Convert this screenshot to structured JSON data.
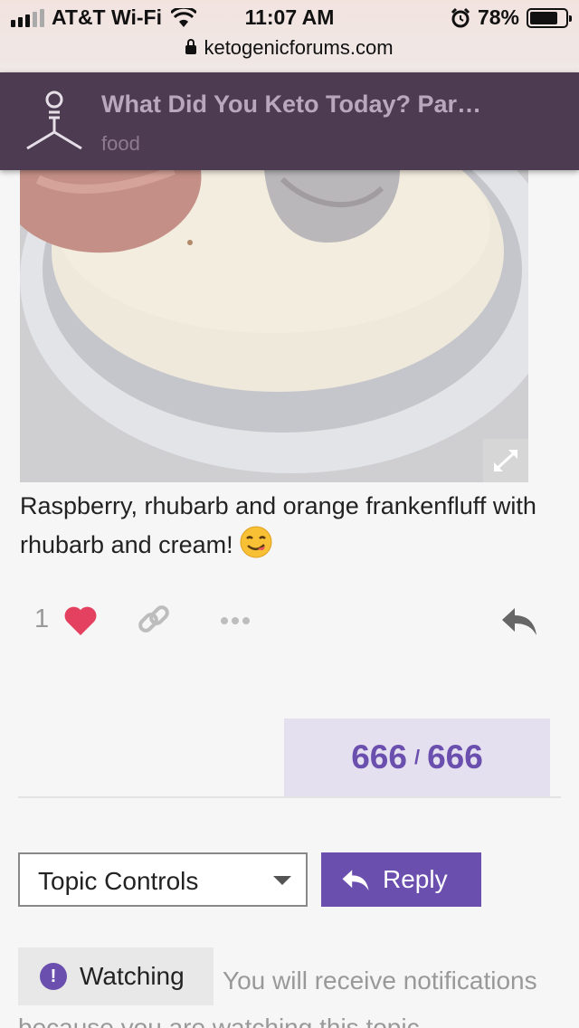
{
  "status_bar": {
    "carrier": "AT&T Wi-Fi",
    "time": "11:07 AM",
    "battery": "78%",
    "battery_level": 0.78,
    "url": "ketogenicforums.com",
    "icons": [
      "signal-icon",
      "wifi-icon",
      "alarm-icon",
      "battery-icon",
      "lock-icon"
    ]
  },
  "topic": {
    "title": "What Did You Keto Today? Par…",
    "category": "food"
  },
  "post": {
    "text": "Raspberry, rhubarb and orange frankenfluff with rhubarb and cream!",
    "like_count": "1",
    "icons": [
      "expand-icon",
      "heart-icon",
      "link-icon",
      "more-icon",
      "reply-icon",
      "yum-emoji"
    ]
  },
  "progress": {
    "current": "666",
    "separator": "/",
    "total": "666"
  },
  "controls": {
    "topic_controls_label": "Topic Controls",
    "reply_label": "Reply"
  },
  "notifications": {
    "level_label": "Watching",
    "level_icon": "!",
    "description": "You will receive notifications because you are watching this topic."
  },
  "colors": {
    "header_bg": "#4d3b52",
    "accent": "#6a4fae",
    "like": "#e4405f",
    "progress_bg": "#e5e0ef"
  }
}
